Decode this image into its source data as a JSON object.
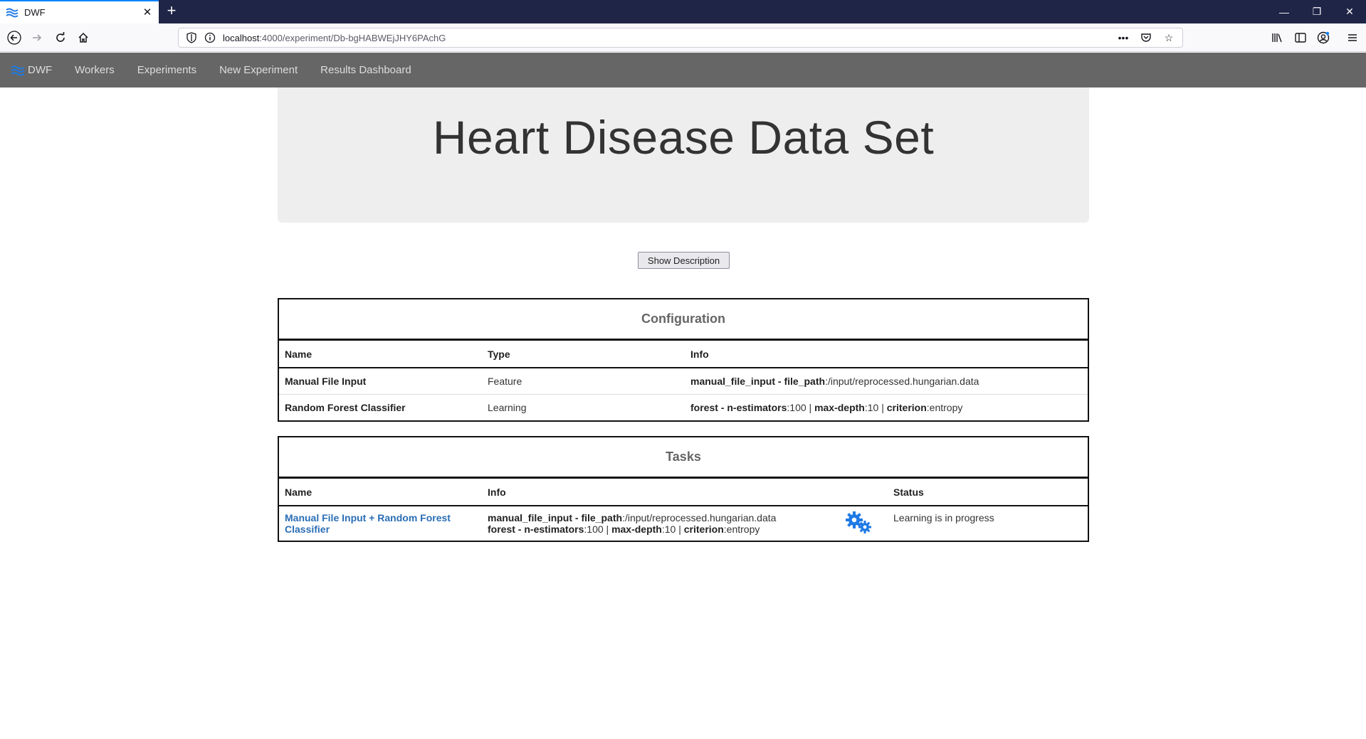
{
  "browser": {
    "tab_title": "DWF",
    "url_host": "localhost",
    "url_path": ":4000/experiment/Db-bgHABWEjJHY6PAchG"
  },
  "app_nav": {
    "brand": "DWF",
    "links": [
      "Workers",
      "Experiments",
      "New Experiment",
      "Results Dashboard"
    ]
  },
  "page": {
    "title": "Heart Disease Data Set",
    "show_description_label": "Show Description"
  },
  "configuration": {
    "title": "Configuration",
    "headers": [
      "Name",
      "Type",
      "Info"
    ],
    "rows": [
      {
        "name": "Manual File Input",
        "type": "Feature",
        "info_key": "manual_file_input",
        "info_sep": " - ",
        "info_param": "file_path",
        "info_value": ":/input/reprocessed.hungarian.data"
      },
      {
        "name": "Random Forest Classifier",
        "type": "Learning",
        "info_key": "forest",
        "info_sep": " - ",
        "params": [
          {
            "k": "n-estimators",
            "v": ":100"
          },
          {
            "k": "max-depth",
            "v": ":10"
          },
          {
            "k": "criterion",
            "v": ":entropy"
          }
        ]
      }
    ]
  },
  "tasks": {
    "title": "Tasks",
    "headers": [
      "Name",
      "Info",
      "Status"
    ],
    "rows": [
      {
        "name": "Manual File Input + Random Forest Classifier",
        "info_line1_key": "manual_file_input",
        "info_line1_param": "file_path",
        "info_line1_value": ":/input/reprocessed.hungarian.data",
        "info_line2_key": "forest",
        "params": [
          {
            "k": "n-estimators",
            "v": ":100"
          },
          {
            "k": "max-depth",
            "v": ":10"
          },
          {
            "k": "criterion",
            "v": ":entropy"
          }
        ],
        "status_icon": "gears-icon",
        "status": "Learning is in progress"
      }
    ]
  },
  "colors": {
    "app_nav_bg": "#666666",
    "jumbotron_bg": "#eeeeee",
    "link": "#2a6eb5",
    "gear": "#1e7ae6",
    "browser_frame": "#1f2546"
  }
}
